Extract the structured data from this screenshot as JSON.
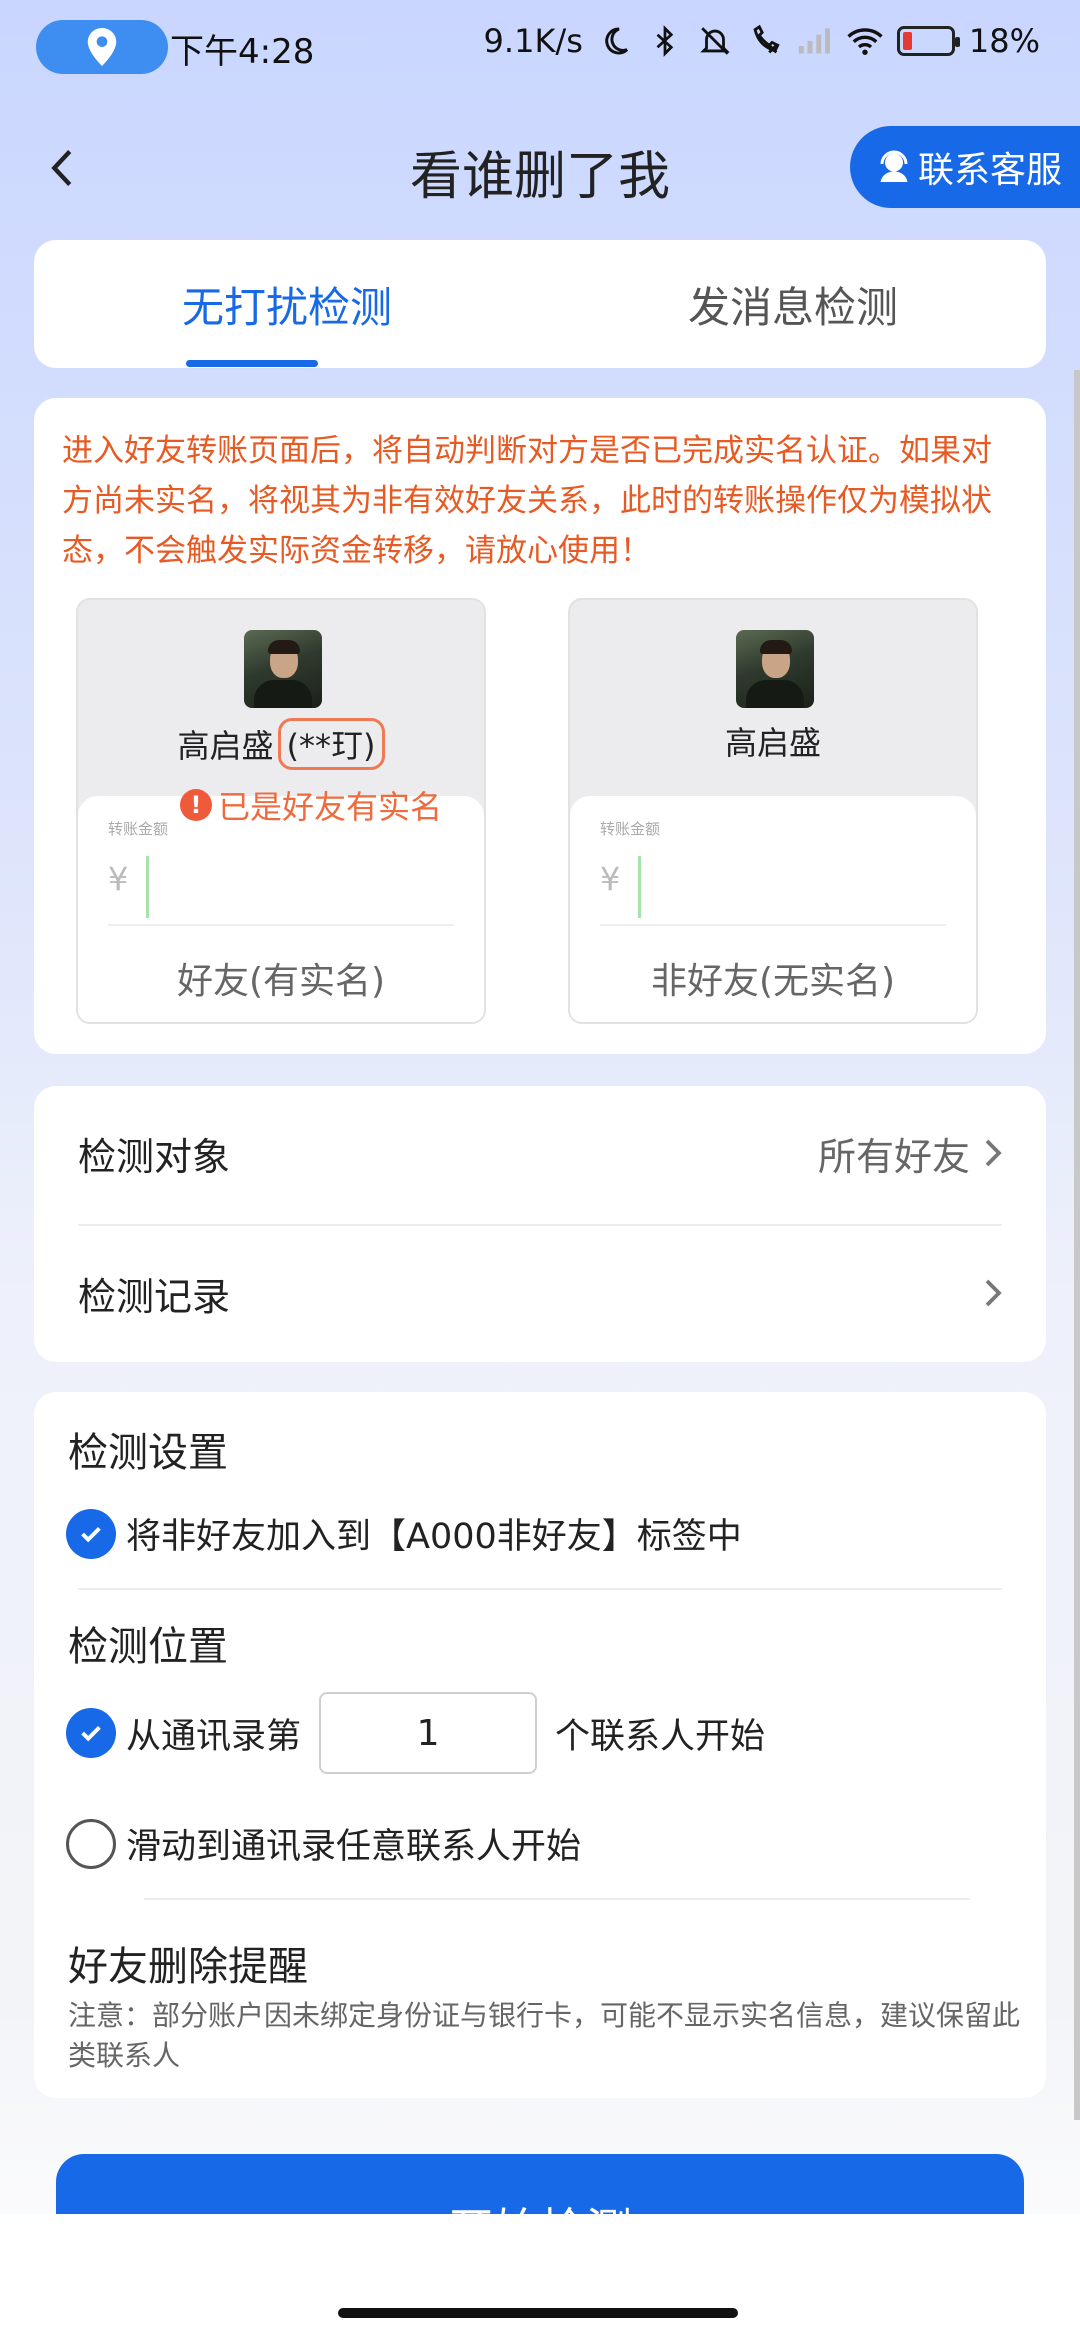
{
  "status_bar": {
    "time": "下午4:28",
    "net_speed": "9.1K/s",
    "battery": "18%",
    "battery_level": 0.18,
    "icons": [
      "location-icon",
      "moon-icon",
      "bluetooth-icon",
      "mute-icon",
      "call-icon",
      "signal-icon",
      "wifi-icon",
      "battery-icon"
    ]
  },
  "header": {
    "title": "看谁删了我",
    "contact_label": "联系客服"
  },
  "tabs": [
    {
      "label": "无打扰检测",
      "active": true
    },
    {
      "label": "发消息检测",
      "active": false
    }
  ],
  "info": {
    "warning": "进入好友转账页面后，将自动判断对方是否已完成实名认证。如果对方尚未实名，将视其为非有效好友关系，此时的转账操作仅为模拟状态，不会触发实际资金转移，请放心使用！",
    "left_demo": {
      "name": "高启盛",
      "masked": "(**玎)",
      "badge": "已是好友有实名",
      "amount_label": "转账金额",
      "currency": "¥",
      "caption": "好友(有实名)"
    },
    "right_demo": {
      "name": "高启盛",
      "amount_label": "转账金额",
      "currency": "¥",
      "caption": "非好友(无实名)"
    }
  },
  "list": {
    "target_label": "检测对象",
    "target_value": "所有好友",
    "record_label": "检测记录"
  },
  "settings": {
    "title": "检测设置",
    "option_tag": "将非好友加入到【A000非好友】标签中",
    "position_title": "检测位置",
    "option_from_prefix": "从通讯录第",
    "option_from_value": "1",
    "option_from_suffix": "个联系人开始",
    "option_scroll": "滑动到通讯录任意联系人开始",
    "reminder_title": "好友删除提醒",
    "note": "注意：部分账户因未绑定身份证与银行卡，可能不显示实名信息，建议保留此类联系人"
  },
  "start_label": "开始检测",
  "colors": {
    "accent": "#1769e8",
    "warning": "#e85a23"
  }
}
